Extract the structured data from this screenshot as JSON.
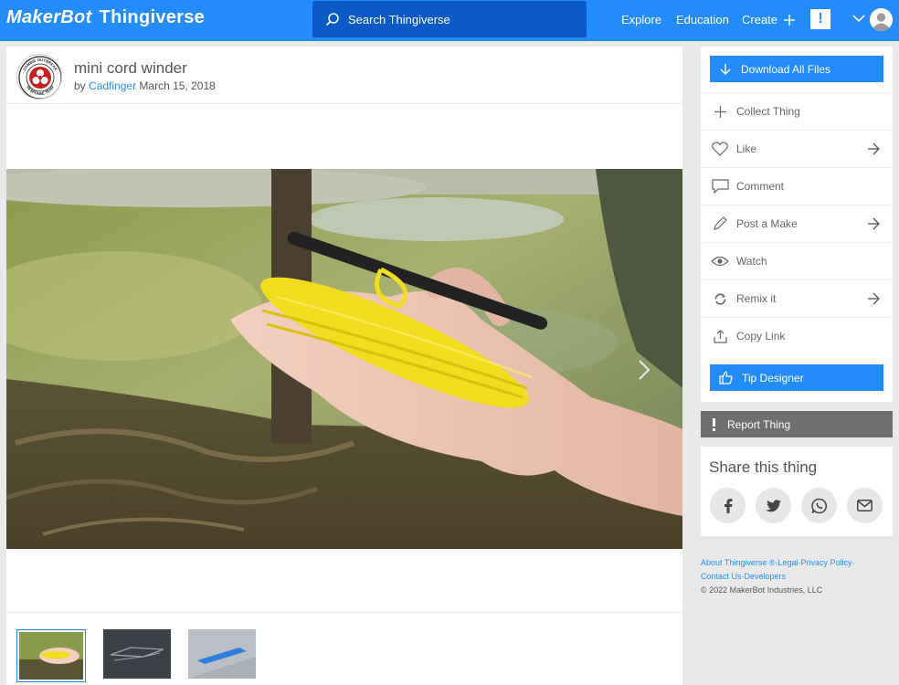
{
  "brand": {
    "maker": "MakerBot",
    "thingiverse": "Thingiverse"
  },
  "search": {
    "placeholder": "Search Thingiverse"
  },
  "nav": {
    "explore": "Explore",
    "education": "Education",
    "create": "Create",
    "notifications": "!"
  },
  "thing": {
    "title": "mini cord winder",
    "by_prefix": "by",
    "author": "Cadfinger",
    "date": "March 15, 2018"
  },
  "creator_badge": {
    "top_text": "ZOMBIE OUTBREAK",
    "bottom_text": "RESPONSE TEAM"
  },
  "actions": {
    "download": "Download All Files",
    "collect": "Collect Thing",
    "like": "Like",
    "comment": "Comment",
    "post_make": "Post a Make",
    "watch": "Watch",
    "remix": "Remix it",
    "copy_link": "Copy Link",
    "tip": "Tip Designer",
    "report": "Report Thing"
  },
  "share": {
    "title": "Share this thing",
    "networks": [
      "facebook",
      "twitter",
      "whatsapp",
      "email"
    ]
  },
  "footer": {
    "about": "About Thingiverse ®",
    "legal": "Legal",
    "privacy": "Privacy Policy",
    "contact": "Contact Us",
    "developers": "Developers",
    "copyright": "©  2022 MakerBot Industries, LLC"
  },
  "thumbnails": [
    "photo-hand",
    "render-dark",
    "render-blue"
  ],
  "colors": {
    "accent": "#248bfb",
    "search_bg": "#0b5ac7",
    "report_bg": "#6f6f6f",
    "cord": "#f2dc1e"
  }
}
